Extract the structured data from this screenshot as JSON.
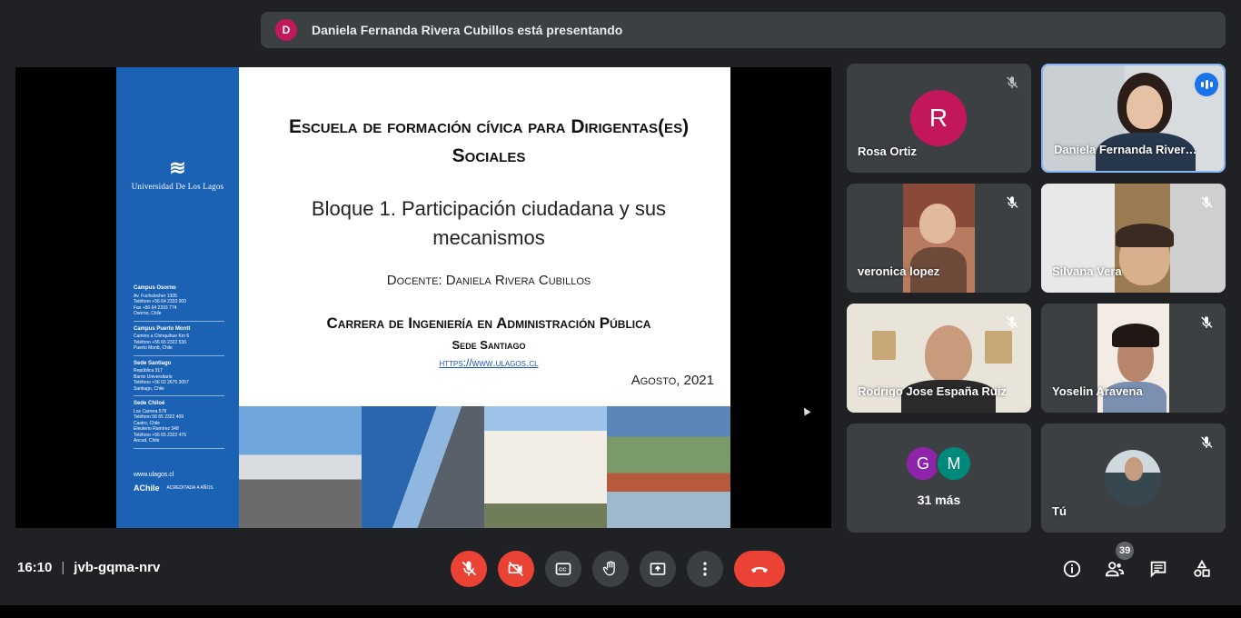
{
  "presenting": {
    "avatar_letter": "D",
    "text": "Daniela Fernanda Rivera Cubillos está presentando"
  },
  "slide": {
    "university": "Universidad De Los Lagos",
    "title_line1": "Escuela de formación cívica para Dirigentas(es)",
    "title_line2": "Sociales",
    "subtitle_line1": "Bloque 1. Participación ciudadana y sus",
    "subtitle_line2": "mecanismos",
    "teacher": "Docente: Daniela Rivera Cubillos",
    "career": "Carrera de Ingeniería en Administración Pública",
    "sede": "Sede Santiago",
    "url": "https://www.ulagos.cl",
    "date": "Agosto, 2021",
    "campus": [
      {
        "title": "Campus Osorno",
        "lines": [
          "Av. Fuchslocher 1305",
          "Teléfono +56 64 2333 000",
          "Fax +56 64 2333 774",
          "Osorno, Chile"
        ]
      },
      {
        "title": "Campus Puerto Montt",
        "lines": [
          "Camino a Chinquihue Km 6",
          "Teléfono +56 65 2322 536",
          "Puerto Montt, Chile"
        ]
      },
      {
        "title": "Sede Santiago",
        "lines": [
          "República 517",
          "Barrio Universitario",
          "Teléfono +56 02 2675 3057",
          "Santiago, Chile"
        ]
      },
      {
        "title": "Sede Chiloé",
        "lines": [
          "Los Carrera 578",
          "Teléfono 56 65 2322 409",
          "Castro, Chile",
          "Eleuterio Ramírez 348",
          "Teléfono +56 65 2322 476",
          "Ancud, Chile"
        ]
      }
    ],
    "web": "www.ulagos.cl",
    "accreditation_logo": "AChile",
    "accreditation_text": "ACREDITADA 4 AÑOS"
  },
  "participants": [
    {
      "name": "Rosa Ortiz",
      "avatar_letter": "R",
      "avatar_color": "#c2185b"
    },
    {
      "name": "Daniela Fernanda River…"
    },
    {
      "name": "veronica lopez"
    },
    {
      "name": "Silvana Vera"
    },
    {
      "name": "Rodrigo Jose España Ruiz"
    },
    {
      "name": "Yoselin Aravena"
    },
    {
      "more_text": "31 más",
      "avatars": [
        {
          "letter": "G",
          "color": "#8e24aa"
        },
        {
          "letter": "M",
          "color": "#00897b"
        }
      ]
    },
    {
      "name": "Tú"
    }
  ],
  "bottom": {
    "time": "16:10",
    "separator": "|",
    "meeting_code": "jvb-gqma-nrv",
    "participant_count": "39"
  },
  "icons": {
    "mic_off": "mic-off-icon",
    "cam_off": "camera-off-icon",
    "captions": "captions-icon",
    "hand": "raise-hand-icon",
    "present": "present-screen-icon",
    "more": "more-options-icon",
    "end": "end-call-icon",
    "info": "info-icon",
    "people": "people-icon",
    "chat": "chat-icon",
    "activities": "activities-icon"
  },
  "colors": {
    "accent": "#8ab4f8",
    "danger": "#ea4335",
    "tile": "#3c4043",
    "background": "#202124",
    "slide_blue": "#1b62b5"
  }
}
